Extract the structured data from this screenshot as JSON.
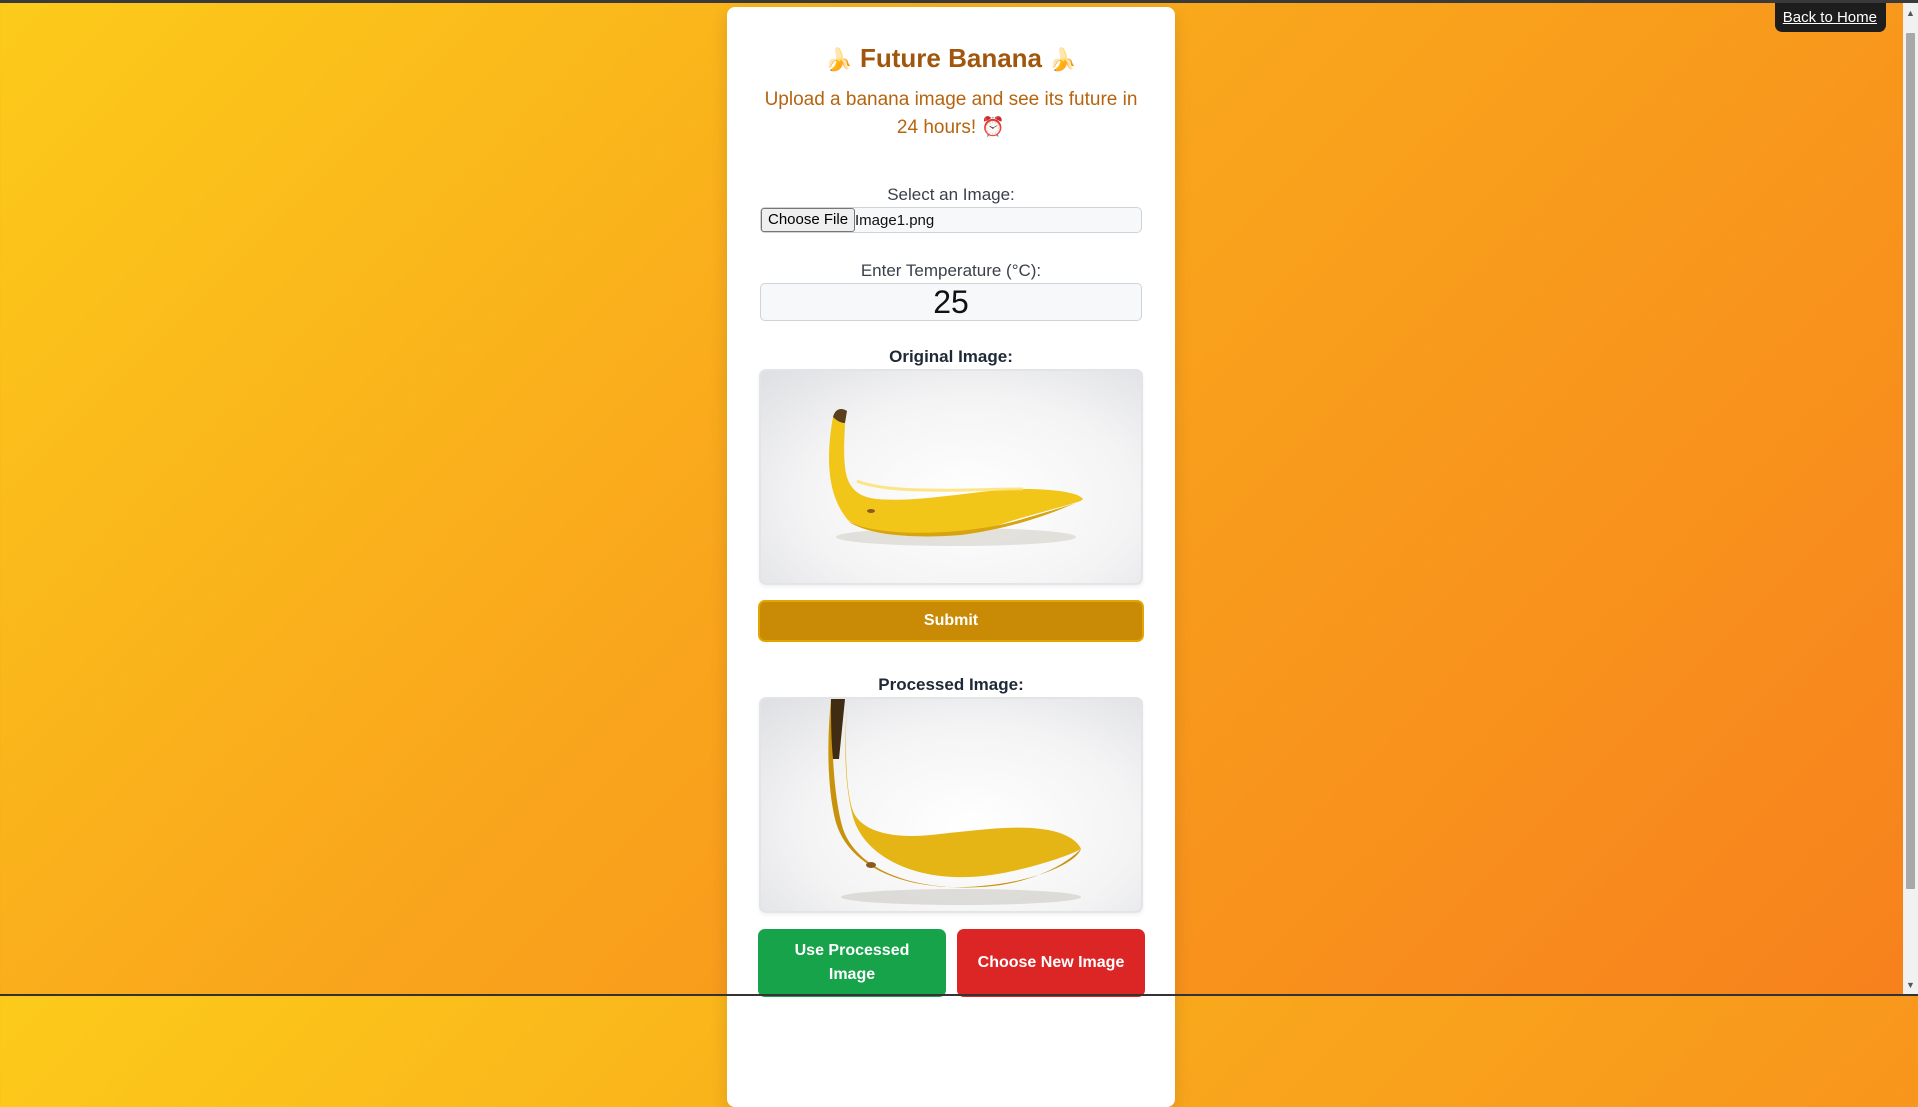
{
  "nav": {
    "back_home": "Back to Home"
  },
  "header": {
    "emoji": "🍌",
    "title": "Future Banana",
    "subtitle": "Upload a banana image and see its future in 24 hours! ⏰"
  },
  "form": {
    "select_label": "Select an Image:",
    "choose_file_label": "Choose File",
    "file_name": "Image1.png",
    "temperature_label": "Enter Temperature (°C):",
    "temperature_value": "25",
    "original_label": "Original Image:",
    "submit_label": "Submit",
    "processed_label": "Processed Image:",
    "use_processed_label": "Use Processed Image",
    "choose_new_label": "Choose New Image"
  },
  "colors": {
    "accent": "#c98a06",
    "title": "#a0560c",
    "success": "#16a34a",
    "danger": "#dc2626"
  }
}
